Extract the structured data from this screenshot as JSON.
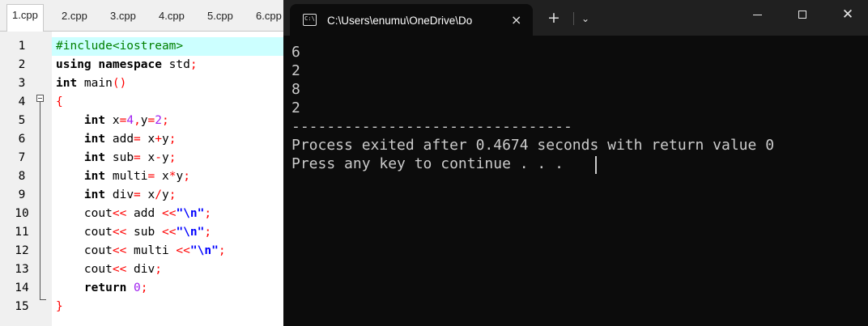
{
  "editor": {
    "tabs": [
      {
        "label": "1.cpp",
        "active": true
      },
      {
        "label": "2.cpp"
      },
      {
        "label": "3.cpp"
      },
      {
        "label": "4.cpp"
      },
      {
        "label": "5.cpp"
      },
      {
        "label": "6.cpp"
      }
    ],
    "line_numbers": [
      "1",
      "2",
      "3",
      "4",
      "5",
      "6",
      "7",
      "8",
      "9",
      "10",
      "11",
      "12",
      "13",
      "14",
      "15"
    ],
    "code": [
      [
        {
          "t": "#include<iostream>",
          "c": "pre"
        }
      ],
      [
        {
          "t": "using namespace",
          "c": "kw"
        },
        {
          "t": " std",
          "c": ""
        },
        {
          "t": ";",
          "c": "op"
        }
      ],
      [
        {
          "t": "int",
          "c": "kw"
        },
        {
          "t": " main",
          "c": ""
        },
        {
          "t": "()",
          "c": "op"
        }
      ],
      [
        {
          "t": "{",
          "c": "op"
        }
      ],
      [
        {
          "t": "    ",
          "c": ""
        },
        {
          "t": "int",
          "c": "kw"
        },
        {
          "t": " x",
          "c": ""
        },
        {
          "t": "=",
          "c": "op"
        },
        {
          "t": "4",
          "c": "num"
        },
        {
          "t": ",",
          "c": "op"
        },
        {
          "t": "y",
          "c": ""
        },
        {
          "t": "=",
          "c": "op"
        },
        {
          "t": "2",
          "c": "num"
        },
        {
          "t": ";",
          "c": "op"
        }
      ],
      [
        {
          "t": "    ",
          "c": ""
        },
        {
          "t": "int",
          "c": "kw"
        },
        {
          "t": " add",
          "c": ""
        },
        {
          "t": "=",
          "c": "op"
        },
        {
          "t": " x",
          "c": ""
        },
        {
          "t": "+",
          "c": "op"
        },
        {
          "t": "y",
          "c": ""
        },
        {
          "t": ";",
          "c": "op"
        }
      ],
      [
        {
          "t": "    ",
          "c": ""
        },
        {
          "t": "int",
          "c": "kw"
        },
        {
          "t": " sub",
          "c": ""
        },
        {
          "t": "=",
          "c": "op"
        },
        {
          "t": " x",
          "c": ""
        },
        {
          "t": "-",
          "c": "op"
        },
        {
          "t": "y",
          "c": ""
        },
        {
          "t": ";",
          "c": "op"
        }
      ],
      [
        {
          "t": "    ",
          "c": ""
        },
        {
          "t": "int",
          "c": "kw"
        },
        {
          "t": " multi",
          "c": ""
        },
        {
          "t": "=",
          "c": "op"
        },
        {
          "t": " x",
          "c": ""
        },
        {
          "t": "*",
          "c": "op"
        },
        {
          "t": "y",
          "c": ""
        },
        {
          "t": ";",
          "c": "op"
        }
      ],
      [
        {
          "t": "    ",
          "c": ""
        },
        {
          "t": "int",
          "c": "kw"
        },
        {
          "t": " div",
          "c": ""
        },
        {
          "t": "=",
          "c": "op"
        },
        {
          "t": " x",
          "c": ""
        },
        {
          "t": "/",
          "c": "op"
        },
        {
          "t": "y",
          "c": ""
        },
        {
          "t": ";",
          "c": "op"
        }
      ],
      [
        {
          "t": "    cout",
          "c": ""
        },
        {
          "t": "<<",
          "c": "op"
        },
        {
          "t": " add ",
          "c": ""
        },
        {
          "t": "<<",
          "c": "op"
        },
        {
          "t": "\"\\n\"",
          "c": "str"
        },
        {
          "t": ";",
          "c": "op"
        }
      ],
      [
        {
          "t": "    cout",
          "c": ""
        },
        {
          "t": "<<",
          "c": "op"
        },
        {
          "t": " sub ",
          "c": ""
        },
        {
          "t": "<<",
          "c": "op"
        },
        {
          "t": "\"\\n\"",
          "c": "str"
        },
        {
          "t": ";",
          "c": "op"
        }
      ],
      [
        {
          "t": "    cout",
          "c": ""
        },
        {
          "t": "<<",
          "c": "op"
        },
        {
          "t": " multi ",
          "c": ""
        },
        {
          "t": "<<",
          "c": "op"
        },
        {
          "t": "\"\\n\"",
          "c": "str"
        },
        {
          "t": ";",
          "c": "op"
        }
      ],
      [
        {
          "t": "    cout",
          "c": ""
        },
        {
          "t": "<<",
          "c": "op"
        },
        {
          "t": " div",
          "c": ""
        },
        {
          "t": ";",
          "c": "op"
        }
      ],
      [
        {
          "t": "    ",
          "c": ""
        },
        {
          "t": "return",
          "c": "kw"
        },
        {
          "t": " ",
          "c": ""
        },
        {
          "t": "0",
          "c": "num"
        },
        {
          "t": ";",
          "c": "op"
        }
      ],
      [
        {
          "t": "}",
          "c": "op"
        }
      ]
    ],
    "current_line": 1
  },
  "terminal": {
    "tab_title": "C:\\Users\\enumu\\OneDrive\\Do",
    "tab_icon": "console-icon",
    "icons": {
      "close_tab": "×",
      "new_tab": "+",
      "dropdown": "⌄",
      "close_window": "✕"
    },
    "output": [
      "6",
      "2",
      "8",
      "2",
      "--------------------------------",
      "Process exited after 0.4674 seconds with return value 0",
      "Press any key to continue . . . "
    ]
  },
  "colors": {
    "keyword": "#000000",
    "operator": "#ff0000",
    "number": "#a020f0",
    "string": "#0000ff",
    "preprocessor": "#008000",
    "current_line_bg": "#ccffff",
    "terminal_bg": "#0c0c0c",
    "terminal_fg": "#cccccc"
  }
}
